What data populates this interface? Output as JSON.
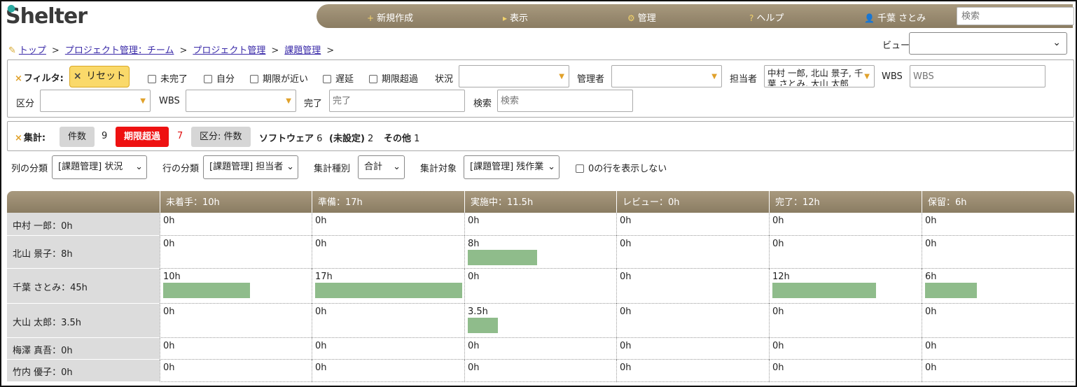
{
  "app": {
    "logo": "Shelter"
  },
  "topnav": {
    "items": [
      {
        "icon": "+",
        "label": "新規作成"
      },
      {
        "icon": "▸",
        "label": "表示"
      },
      {
        "icon": "⚙",
        "label": "管理"
      },
      {
        "icon": "?",
        "label": "ヘルプ"
      },
      {
        "icon": "👤",
        "label": "千葉 さとみ"
      }
    ],
    "search_placeholder": "検索"
  },
  "breadcrumb": {
    "items": [
      "トップ",
      "プロジェクト管理：チーム",
      "プロジェクト管理",
      "課題管理"
    ],
    "separator": ">"
  },
  "view": {
    "label": "ビュー",
    "value": ""
  },
  "filter": {
    "title": "フィルタ:",
    "reset_label": "リセット",
    "checkboxes": [
      "未完了",
      "自分",
      "期限が近い",
      "遅延",
      "期限超過"
    ],
    "status_label": "状況",
    "manager_label": "管理者",
    "assignee_label": "担当者",
    "assignee_value": "中村 一郎, 北山 景子, 千葉 さとみ, 大山 太郎",
    "wbs_label": "WBS",
    "wbs_placeholder": "WBS",
    "category_label": "区分",
    "wbs2_label": "WBS",
    "done_label": "完了",
    "done_placeholder": "完了",
    "search_label": "検索",
    "search_placeholder": "検索"
  },
  "summary": {
    "title": "集計:",
    "count_chip": "件数",
    "count_value": "9",
    "overdue_chip": "期限超過",
    "overdue_value": "7",
    "category_chip": "区分: 件数",
    "software_label": "ソフトウェア",
    "software_value": "6",
    "unset_label": "(未設定)",
    "unset_value": "2",
    "other_label": "その他",
    "other_value": "1"
  },
  "controls": {
    "col_label": "列の分類",
    "col_value": "[課題管理] 状況",
    "row_label": "行の分類",
    "row_value": "[課題管理] 担当者",
    "agg_label": "集計種別",
    "agg_value": "合計",
    "target_label": "集計対象",
    "target_value": "[課題管理] 残作業",
    "hide_zero_label": "0の行を表示しない"
  },
  "pivot": {
    "columns": [
      "未着手：10h",
      "準備：17h",
      "実施中：11.5h",
      "レビュー：0h",
      "完了：12h",
      "保留：6h"
    ],
    "rows": [
      {
        "label": "中村 一郎：0h",
        "cells": [
          "0h",
          "0h",
          "0h",
          "0h",
          "0h",
          "0h"
        ],
        "values": [
          0,
          0,
          0,
          0,
          0,
          0
        ]
      },
      {
        "label": "北山 景子：8h",
        "cells": [
          "0h",
          "0h",
          "8h",
          "0h",
          "0h",
          "0h"
        ],
        "values": [
          0,
          0,
          8,
          0,
          0,
          0
        ]
      },
      {
        "label": "千葉 さとみ：45h",
        "cells": [
          "10h",
          "17h",
          "0h",
          "0h",
          "12h",
          "6h"
        ],
        "values": [
          10,
          17,
          0,
          0,
          12,
          6
        ]
      },
      {
        "label": "大山 太郎：3.5h",
        "cells": [
          "0h",
          "0h",
          "3.5h",
          "0h",
          "0h",
          "0h"
        ],
        "values": [
          0,
          0,
          3.5,
          0,
          0,
          0
        ]
      },
      {
        "label": "梅澤 真吾：0h",
        "cells": [
          "0h",
          "0h",
          "0h",
          "0h",
          "0h",
          "0h"
        ],
        "values": [
          0,
          0,
          0,
          0,
          0,
          0
        ]
      },
      {
        "label": "竹内 優子：0h",
        "cells": [
          "0h",
          "0h",
          "0h",
          "0h",
          "0h",
          "0h"
        ],
        "values": [
          0,
          0,
          0,
          0,
          0,
          0
        ]
      }
    ],
    "bar_max": 17,
    "bar_color": "#8fbc8b"
  }
}
